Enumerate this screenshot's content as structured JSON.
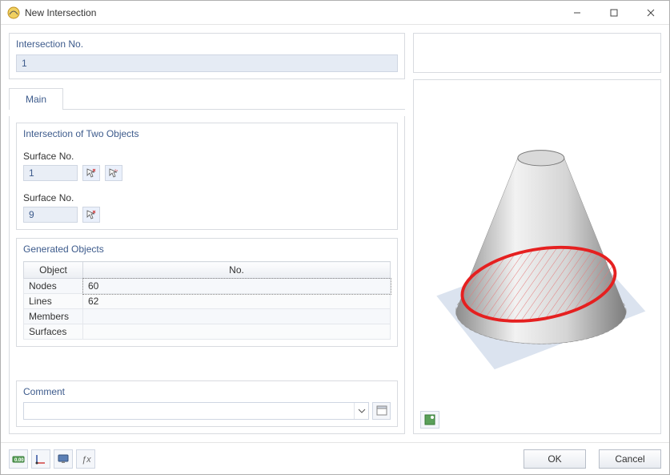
{
  "window_title": "New Intersection",
  "top_group": {
    "title": "Intersection No.",
    "value": "1"
  },
  "tabs": [
    {
      "label": "Main"
    }
  ],
  "intersection_group": {
    "title": "Intersection of Two Objects",
    "surface1_label": "Surface No.",
    "surface1_value": "1",
    "surface2_label": "Surface No.",
    "surface2_value": "9"
  },
  "generated_group": {
    "title": "Generated Objects",
    "col_object": "Object",
    "col_no": "No.",
    "rows": [
      {
        "object": "Nodes",
        "no": "60"
      },
      {
        "object": "Lines",
        "no": "62"
      },
      {
        "object": "Members",
        "no": ""
      },
      {
        "object": "Surfaces",
        "no": ""
      }
    ]
  },
  "comment_group": {
    "title": "Comment",
    "value": ""
  },
  "buttons": {
    "ok": "OK",
    "cancel": "Cancel"
  }
}
